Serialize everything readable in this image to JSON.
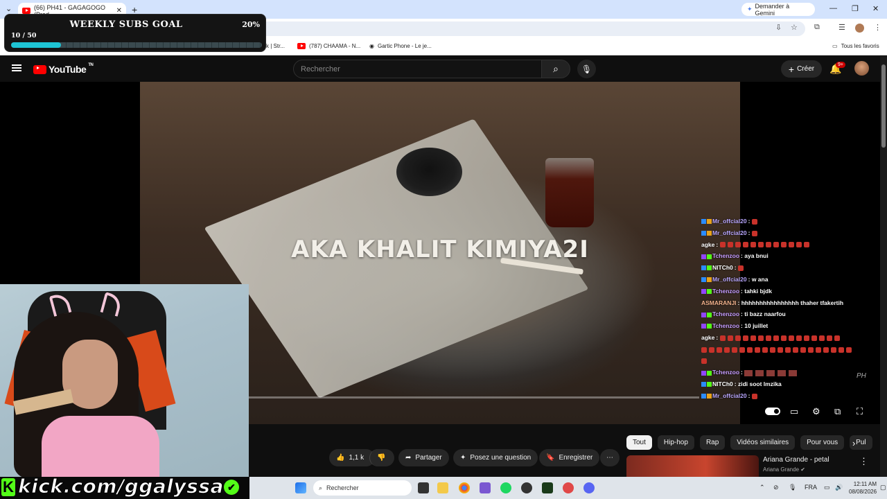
{
  "browser": {
    "tab_title": "(66) PH41 - GAGAGOGO (Prod",
    "new_tab": "+",
    "gemini_button": "Demander à Gemini",
    "bookmarks": [
      {
        "label": "k | Str..."
      },
      {
        "label": "(787) CHAAMA - N..."
      },
      {
        "label": "Gartic Phone - Le je..."
      }
    ],
    "all_favorites": "Tous les favoris"
  },
  "youtube": {
    "logo_text": "YouTube",
    "logo_tm": "TN",
    "search_placeholder": "Rechercher",
    "create_label": "Créer",
    "notif_badge": "9+",
    "video_overlay_title": "AKA KHALIT KIMIYA2I",
    "actions": {
      "likes": "1,1 k",
      "share": "Partager",
      "ask": "Posez une question",
      "save": "Enregistrer"
    },
    "chips": [
      "Tout",
      "Hip-hop",
      "Rap",
      "Vidéos similaires",
      "Pour vous",
      "Pul"
    ],
    "recommendation": {
      "title": "Ariana Grande - petal",
      "channel": "Ariana Grande"
    }
  },
  "stream_overlay": {
    "goal_title": "WEEKLY SUBS GOAL",
    "goal_percent": "20%",
    "goal_count": "10 / 50",
    "goal_progress": 0.2,
    "kick_handle": "kick.com/ggalyssa",
    "watermark": "PH"
  },
  "chat": [
    {
      "user": "Mr_offcial20",
      "color": "#b9a7ff",
      "msg": "",
      "emotes": 1,
      "badges": [
        "#2b8cff",
        "#e8a31b"
      ]
    },
    {
      "user": "Mr_offcial20",
      "color": "#b9a7ff",
      "msg": "",
      "emotes": 1,
      "badges": [
        "#2b8cff",
        "#e8a31b"
      ]
    },
    {
      "user": "agke",
      "color": "#ffffff",
      "msg": "",
      "emotes": 12,
      "badges": []
    },
    {
      "user": "Tchenzoo",
      "color": "#c59cff",
      "msg": "aya bnui",
      "emotes": 0,
      "badges": [
        "#9146ff",
        "#53fc18"
      ]
    },
    {
      "user": "NITCh0",
      "color": "#ffffff",
      "msg": "",
      "emotes": 1,
      "badges": [
        "#2b8cff",
        "#53fc18"
      ]
    },
    {
      "user": "Mr_offcial20",
      "color": "#b9a7ff",
      "msg": "w ana",
      "emotes": 0,
      "badges": [
        "#2b8cff",
        "#e8a31b"
      ]
    },
    {
      "user": "Tchenzoo",
      "color": "#c59cff",
      "msg": "tahki bjdk",
      "emotes": 0,
      "badges": [
        "#9146ff",
        "#53fc18"
      ]
    },
    {
      "user": "ASMARANJI",
      "color": "#f2b28c",
      "msg": "hhhhhhhhhhhhhhhh thaher tfakertih",
      "emotes": 0,
      "badges": []
    },
    {
      "user": "Tchenzoo",
      "color": "#c59cff",
      "msg": "ti bazz naarfou",
      "emotes": 0,
      "badges": [
        "#9146ff",
        "#53fc18"
      ]
    },
    {
      "user": "Tchenzoo",
      "color": "#c59cff",
      "msg": "10 juillet",
      "emotes": 0,
      "badges": [
        "#9146ff",
        "#53fc18"
      ]
    },
    {
      "user": "agke",
      "color": "#ffffff",
      "msg": "",
      "emotes": 16,
      "badges": []
    },
    {
      "user": "",
      "color": "#ffffff",
      "msg": "",
      "emotes": 20,
      "badges": []
    },
    {
      "user": "",
      "color": "#ffffff",
      "msg": "",
      "emotes": 1,
      "badges": []
    },
    {
      "user": "Tchenzoo",
      "color": "#c59cff",
      "msg": "",
      "emotes": 5,
      "badges": [
        "#9146ff",
        "#53fc18"
      ],
      "large": true
    },
    {
      "user": "NITCh0",
      "color": "#ffffff",
      "msg": "zidi soot lmzika",
      "emotes": 0,
      "badges": [
        "#2b8cff",
        "#53fc18"
      ]
    },
    {
      "user": "Mr_offcial20",
      "color": "#b9a7ff",
      "msg": "",
      "emotes": 1,
      "badges": [
        "#2b8cff",
        "#e8a31b"
      ]
    }
  ],
  "taskbar": {
    "search_placeholder": "Rechercher",
    "lang": "FRA",
    "time": "12:11 AM",
    "date": "08/08/2026"
  }
}
